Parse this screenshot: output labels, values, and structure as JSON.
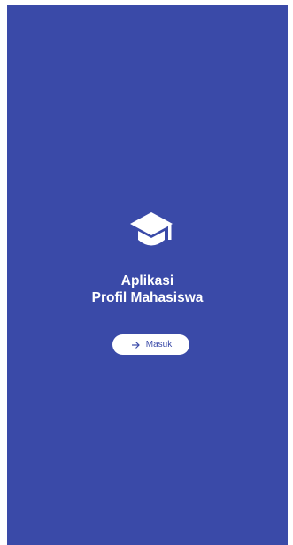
{
  "app": {
    "title_line1": "Aplikasi",
    "title_line2": "Profil Mahasiswa"
  },
  "login_button": {
    "label": "Masuk",
    "icon": "arrow-right-icon"
  },
  "logo": {
    "icon": "graduation-cap-icon"
  },
  "colors": {
    "background": "#3a4aa8",
    "foreground": "#ffffff",
    "accent": "#3a4aa8"
  }
}
